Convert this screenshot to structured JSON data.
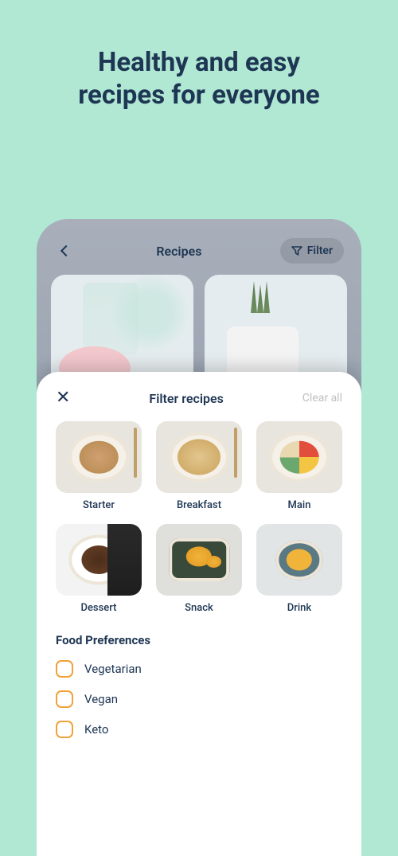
{
  "hero": {
    "line1": "Healthy and easy",
    "line2": "recipes for everyone"
  },
  "app_header": {
    "title": "Recipes",
    "filter_label": "Filter"
  },
  "sheet": {
    "title": "Filter recipes",
    "clear_label": "Clear all",
    "categories": [
      {
        "id": "starter",
        "label": "Starter"
      },
      {
        "id": "breakfast",
        "label": "Breakfast"
      },
      {
        "id": "main",
        "label": "Main"
      },
      {
        "id": "dessert",
        "label": "Dessert"
      },
      {
        "id": "snack",
        "label": "Snack"
      },
      {
        "id": "drink",
        "label": "Drink"
      }
    ],
    "prefs_title": "Food Preferences",
    "prefs": [
      {
        "id": "vegetarian",
        "label": "Vegetarian",
        "checked": false
      },
      {
        "id": "vegan",
        "label": "Vegan",
        "checked": false
      },
      {
        "id": "keto",
        "label": "Keto",
        "checked": false
      }
    ]
  }
}
